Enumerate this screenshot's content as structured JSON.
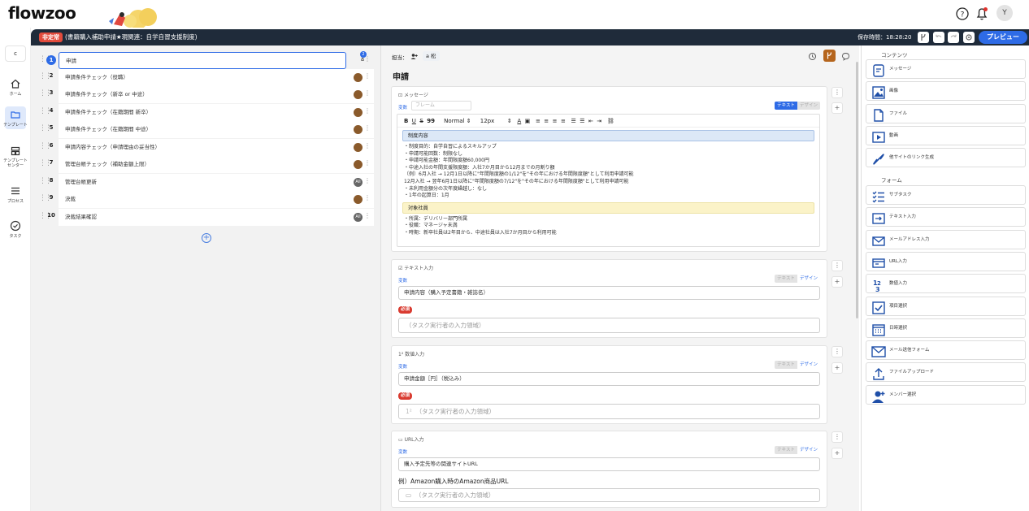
{
  "app": {
    "logo": "flowzoo",
    "user_initial": "Y"
  },
  "titlebar": {
    "status_badge": "非定常",
    "flow_title": "(書籍購入補助申請★現関連：自学自習支援制度)",
    "save_time": "保存時間：18:28:20",
    "preview_label": "プレビュー"
  },
  "rail": {
    "top_label": "c",
    "items": [
      {
        "label": "ホーム",
        "icon": "home-icon"
      },
      {
        "label": "テンプレート",
        "icon": "folder-icon"
      },
      {
        "label": "テンプレートセンター",
        "icon": "template-center-icon"
      },
      {
        "label": "プロセス",
        "icon": "list-icon"
      },
      {
        "label": "タスク",
        "icon": "check-circle-icon"
      }
    ]
  },
  "steps": [
    {
      "num": "1",
      "name": "申請",
      "assignee": "a",
      "count": "2"
    },
    {
      "num": "2",
      "name": "申請条件チェック（役職）",
      "assignee": "user"
    },
    {
      "num": "3",
      "name": "申請条件チェック（新卒 or 中途）",
      "assignee": "user"
    },
    {
      "num": "4",
      "name": "申請条件チェック（在籍期間 新卒）",
      "assignee": "user"
    },
    {
      "num": "5",
      "name": "申請条件チェック（在籍期間 中途）",
      "assignee": "user"
    },
    {
      "num": "6",
      "name": "申請内容チェック（申請理由の妥当性）",
      "assignee": "user"
    },
    {
      "num": "7",
      "name": "管理台帳チェック（補助金額上限）",
      "assignee": "user"
    },
    {
      "num": "8",
      "name": "管理台帳更新",
      "assignee": "All"
    },
    {
      "num": "9",
      "name": "決裁",
      "assignee": "user"
    },
    {
      "num": "10",
      "name": "決裁結果確認",
      "assignee": "All"
    }
  ],
  "editor": {
    "assignee_label": "担当：",
    "assignee_name": "a 松",
    "step_title": "申請",
    "message_card": {
      "type": "メッセージ",
      "var": "変数",
      "frame_placeholder": "フレーム",
      "tab_text": "テキスト",
      "tab_design": "デザイン",
      "toolbar": {
        "style": "Normal",
        "size": "12px"
      },
      "heading1": "制度内容",
      "lines1": [
        "・制度目的：自学自習によるスキルアップ",
        "・申請可能回数：制限なし",
        "・申請可能金額：年間限度額60,000円",
        "・中途入社の年間支援限度額：入社7か月目から12月までの月割り額",
        "（例）6月入社 → 12月1日以降に\"年間限度額の1/12\"を\"その年における年間限度額\"として利用申請可能",
        "12月入社 → 翌年6月1日以降に\"年間限度額の7/12\"を\"その年における年間限度額\"として利用申請可能",
        "・未利用金額分の次年度繰越し：なし",
        "・1年の起算日：1月"
      ],
      "heading2": "対象社員",
      "lines2": [
        "・所属：デリバリー部門所属",
        "・役職：マネージャ未満",
        "・時期：新卒社員は2年目から、中途社員は入社7か月目から利用可能"
      ]
    },
    "text_card": {
      "type": "テキスト入力",
      "var": "変数",
      "tab_text": "テキスト",
      "tab_design": "デザイン",
      "label": "申請内容（購入予定書籍・雑誌名）",
      "required": "必須",
      "placeholder": "（タスク実行者の入力領域）"
    },
    "number_card": {
      "type": "数値入力",
      "var": "変数",
      "tab_text": "テキスト",
      "tab_design": "デザイン",
      "label": "申請金額［円］（税込み）",
      "required": "必須",
      "placeholder": "（タスク実行者の入力領域）"
    },
    "url_card": {
      "type": "URL入力",
      "var": "変数",
      "tab_text": "テキスト",
      "tab_design": "デザイン",
      "label": "購入予定先等の関連サイトURL",
      "example": "例）Amazon購入時のAmazon商品URL",
      "placeholder": "（タスク実行者の入力領域）"
    }
  },
  "palette": {
    "contents_header": "コンテンツ",
    "contents": [
      {
        "label": "メッセージ",
        "icon": "message-icon"
      },
      {
        "label": "画像",
        "icon": "image-icon"
      },
      {
        "label": "ファイル",
        "icon": "file-icon"
      },
      {
        "label": "動画",
        "icon": "video-icon"
      },
      {
        "label": "他サイトのリンク生成",
        "icon": "link-icon"
      }
    ],
    "form_header": "フォーム",
    "forms": [
      {
        "label": "サブタスク",
        "icon": "subtask-icon"
      },
      {
        "label": "テキスト入力",
        "icon": "text-input-icon"
      },
      {
        "label": "メールアドレス入力",
        "icon": "email-icon"
      },
      {
        "label": "URL入力",
        "icon": "url-icon"
      },
      {
        "label": "数値入力",
        "icon": "number-icon"
      },
      {
        "label": "項目選択",
        "icon": "checkbox-icon"
      },
      {
        "label": "日時選択",
        "icon": "calendar-icon"
      },
      {
        "label": "メール送信フォーム",
        "icon": "mail-send-icon"
      },
      {
        "label": "ファイルアップロード",
        "icon": "upload-icon"
      },
      {
        "label": "メンバー選択",
        "icon": "member-icon"
      }
    ]
  }
}
